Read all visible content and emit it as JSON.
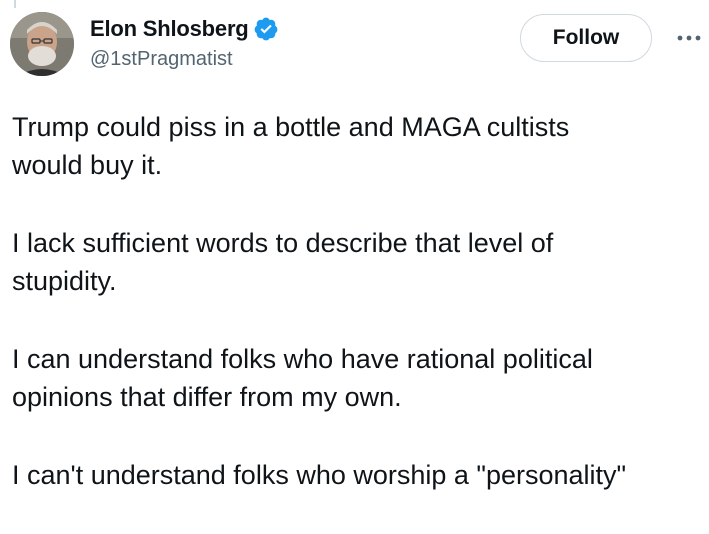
{
  "author": {
    "display_name": "Elon Shlosberg",
    "handle": "@1stPragmatist",
    "verified": true,
    "verified_color": "#1d9bf0"
  },
  "actions": {
    "follow_label": "Follow",
    "more_icon": "more-horizontal-icon"
  },
  "tweet": {
    "paragraphs": [
      [
        "Trump could piss in a bottle and MAGA cultists",
        "would buy it."
      ],
      [
        "I lack sufficient words to describe that level of",
        "stupidity."
      ],
      [
        "I can understand folks who have rational political",
        "opinions that differ from my own."
      ],
      [
        "I can't understand folks who worship a \"personality\""
      ]
    ]
  },
  "colors": {
    "text": "#0f1419",
    "secondary": "#536471",
    "border": "#cfd9de"
  }
}
